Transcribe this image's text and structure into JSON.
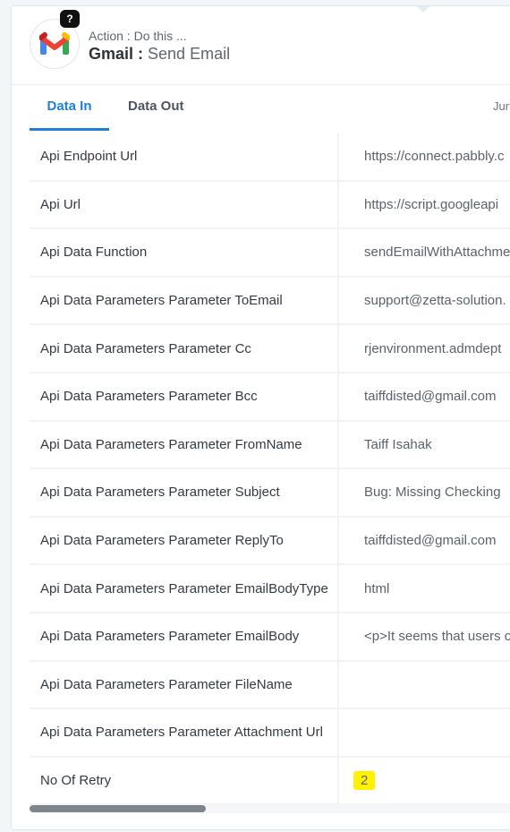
{
  "header": {
    "action_label": "Action : Do this ...",
    "app_name": "Gmail :",
    "action_name": "Send Email",
    "help_glyph": "?"
  },
  "tabs": [
    {
      "label": "Data In",
      "active": true
    },
    {
      "label": "Data Out",
      "active": false
    },
    {
      "label": "Jur",
      "active": false
    }
  ],
  "rows": [
    {
      "key": "Api Endpoint Url",
      "value": "https://connect.pabbly.c"
    },
    {
      "key": "Api Url",
      "value": "https://script.googleapi"
    },
    {
      "key": "Api Data Function",
      "value": "sendEmailWithAttachme"
    },
    {
      "key": "Api Data Parameters Parameter ToEmail",
      "value": "support@zetta-solution."
    },
    {
      "key": "Api Data Parameters Parameter Cc",
      "value": "rjenvironment.admdept"
    },
    {
      "key": "Api Data Parameters Parameter Bcc",
      "value": "taiffdisted@gmail.com"
    },
    {
      "key": "Api Data Parameters Parameter FromName",
      "value": "Taiff Isahak"
    },
    {
      "key": "Api Data Parameters Parameter Subject",
      "value": "Bug: Missing Checking"
    },
    {
      "key": "Api Data Parameters Parameter ReplyTo",
      "value": "taiffdisted@gmail.com"
    },
    {
      "key": "Api Data Parameters Parameter EmailBodyType",
      "value": "html"
    },
    {
      "key": "Api Data Parameters Parameter EmailBody",
      "value": "<p>It seems that users c"
    },
    {
      "key": "Api Data Parameters Parameter FileName",
      "value": ""
    },
    {
      "key": "Api Data Parameters Parameter Attachment Url",
      "value": ""
    },
    {
      "key": "No Of Retry",
      "value": "2"
    }
  ],
  "colors": {
    "accent": "#1f7fd6",
    "highlight": "#fff100",
    "gmail_red": "#ea4335",
    "gmail_blue": "#4285f4",
    "gmail_green": "#34a853",
    "gmail_yellow": "#fbbc04"
  },
  "icons": {
    "app": "gmail-logo-icon",
    "help": "help-badge-icon"
  },
  "scroll": {
    "horizontal_position": 0
  }
}
